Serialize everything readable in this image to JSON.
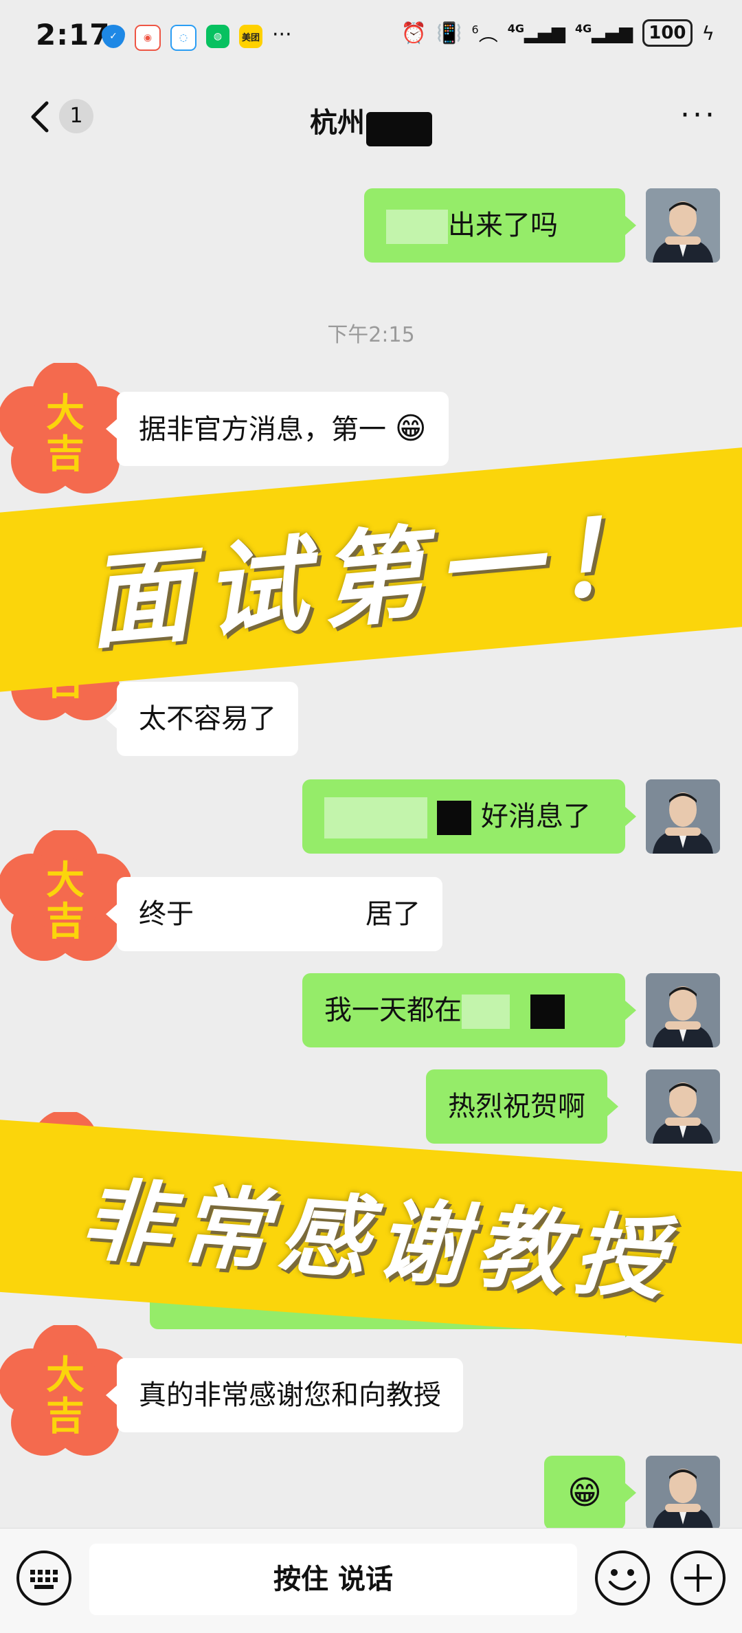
{
  "status_bar": {
    "time": "2:17",
    "app_icons": [
      "shield-icon",
      "weibo-icon",
      "qq-browser-icon",
      "wechat-icon",
      "meituan-icon"
    ],
    "meituan_label": "美团",
    "more": "···",
    "network_1": "4G",
    "network_2": "4G",
    "wifi_label": "6",
    "battery": "100"
  },
  "nav": {
    "unread_count": "1",
    "title": "杭州",
    "more": "···"
  },
  "messages": {
    "m1": "出来了吗",
    "timestamp": "下午2:15",
    "m2": "据非官方消息，第一",
    "m3": "太不容易了",
    "m4": "好消息了",
    "m5_a": "终于",
    "m5_b": "居了",
    "m6": "我一天都在",
    "m7": "热烈祝贺啊",
    "m8": "真的非常感谢您和向教授"
  },
  "badges": {
    "flower_text_top": "大",
    "flower_text_bottom": "吉"
  },
  "banners": {
    "banner1": "面试第一！",
    "banner2": "非常感谢教授"
  },
  "input_bar": {
    "voice_label": "按住 说话"
  },
  "colors": {
    "my_bubble": "#95ec69",
    "their_bubble": "#ffffff",
    "banner": "#fbd50b",
    "flower": "#f46a4e",
    "flower_text": "#fbd50b"
  }
}
